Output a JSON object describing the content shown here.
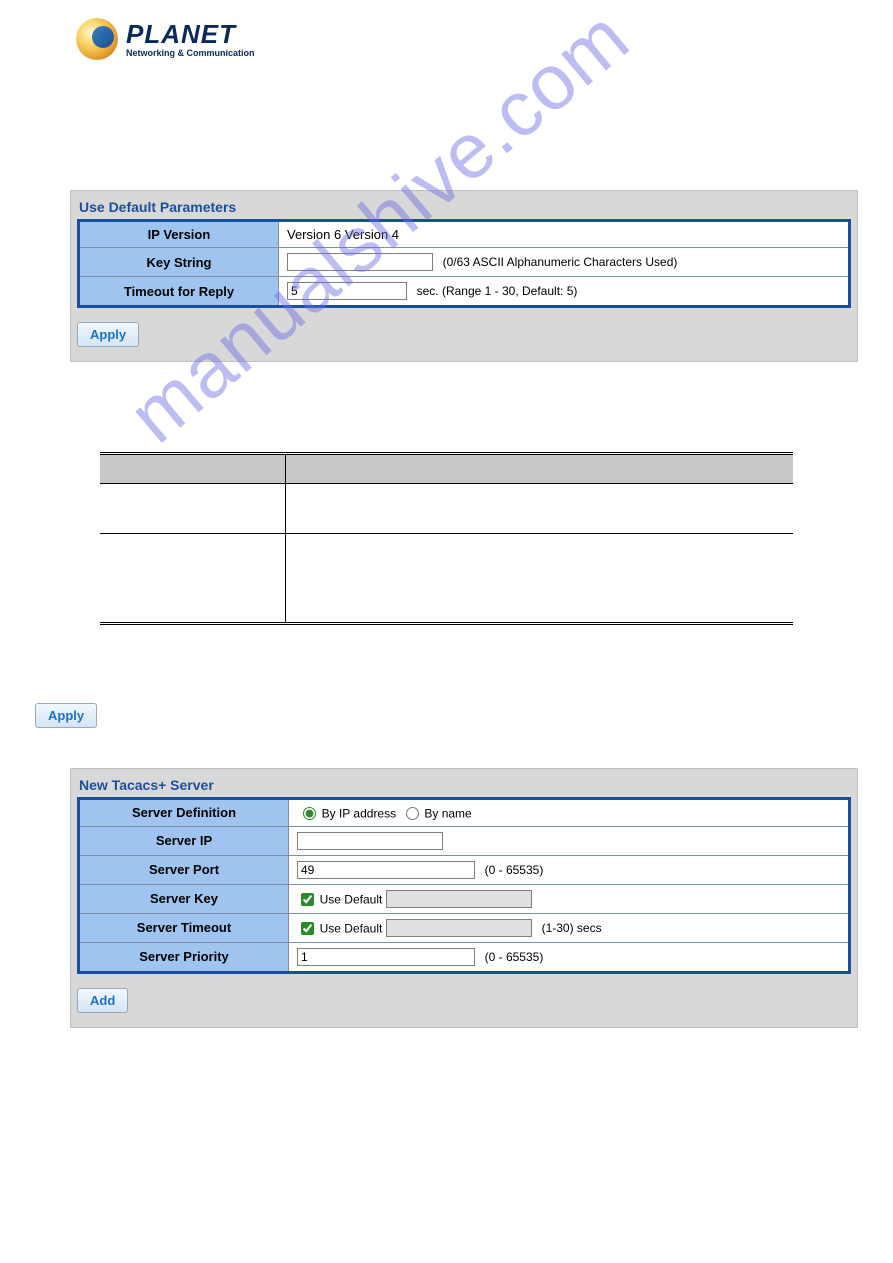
{
  "brand": {
    "name": "PLANET",
    "tagline": "Networking & Communication"
  },
  "watermark": "manualshive.com",
  "panel1": {
    "title": "Use Default Parameters",
    "rows": {
      "ip_version": {
        "label": "IP Version",
        "value": "Version 6 Version 4"
      },
      "key_string": {
        "label": "Key String",
        "value": "",
        "hint": "(0/63 ASCII Alphanumeric Characters Used)"
      },
      "timeout": {
        "label": "Timeout for Reply",
        "value": "5",
        "hint": "sec. (Range 1 - 30, Default: 5)"
      }
    },
    "apply": "Apply"
  },
  "apply_outside": "Apply",
  "panel2": {
    "title": "New Tacacs+ Server",
    "rows": {
      "definition": {
        "label": "Server Definition",
        "opt_ip": "By IP address",
        "opt_name": "By name"
      },
      "ip": {
        "label": "Server IP",
        "value": ""
      },
      "port": {
        "label": "Server Port",
        "value": "49",
        "hint": "(0 - 65535)"
      },
      "key": {
        "label": "Server Key",
        "use_default": "Use Default",
        "value": ""
      },
      "timeout": {
        "label": "Server Timeout",
        "use_default": "Use Default",
        "value": "",
        "hint": "(1-30) secs"
      },
      "priority": {
        "label": "Server Priority",
        "value": "1",
        "hint": "(0 - 65535)"
      }
    },
    "add": "Add"
  }
}
